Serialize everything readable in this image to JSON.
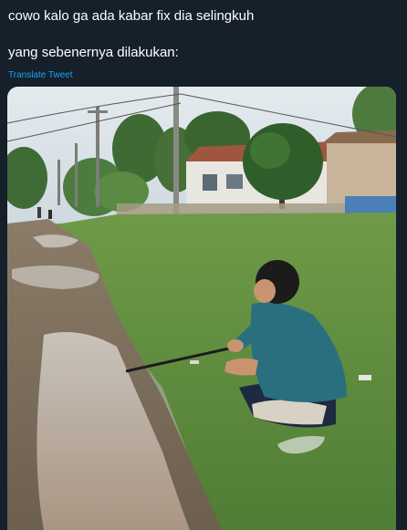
{
  "tweet": {
    "text": "cowo kalo ga ada kabar fix dia selingkuh\n\nyang sebenernya dilakukan:",
    "translate_label": "Translate Tweet"
  },
  "media": {
    "type": "photo",
    "subject": "man-crouching-fishing-in-puddle"
  },
  "colors": {
    "background": "#15202b",
    "text": "#ffffff",
    "link": "#1da1f2"
  }
}
